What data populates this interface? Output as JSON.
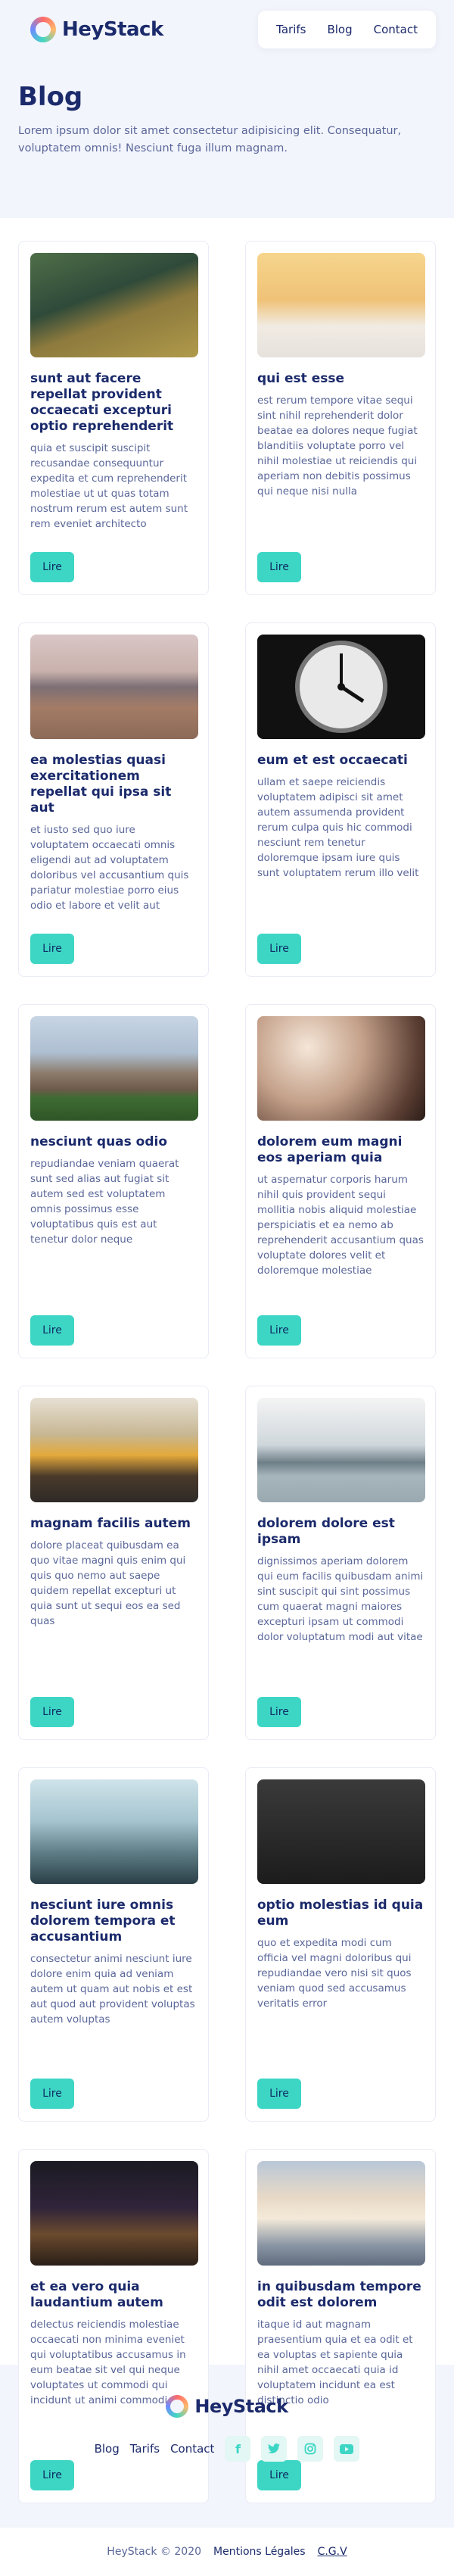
{
  "brand": {
    "name": "HeyStack"
  },
  "nav": {
    "items": [
      "Tarifs",
      "Blog",
      "Contact"
    ]
  },
  "hero": {
    "title": "Blog",
    "subtitle": "Lorem ipsum dolor sit amet consectetur adipisicing elit. Consequatur, voluptatem omnis! Nesciunt fuga illum magnam."
  },
  "posts": [
    {
      "title": "sunt aut facere repellat provident occaecati excepturi optio reprehenderit",
      "body": "quia et suscipit suscipit recusandae consequuntur expedita et cum reprehenderit molestiae ut ut quas totam nostrum rerum est autem sunt rem eveniet architecto",
      "button": "Lire",
      "image": "tree"
    },
    {
      "title": "qui est esse",
      "body": "est rerum tempore vitae sequi sint nihil reprehenderit dolor beatae ea dolores neque fugiat blanditiis voluptate porro vel nihil molestiae ut reiciendis qui aperiam non debitis possimus qui neque nisi nulla",
      "button": "Lire",
      "image": "berries"
    },
    {
      "title": "ea molestias quasi exercitationem repellat qui ipsa sit aut",
      "body": "et iusto sed quo iure voluptatem occaecati omnis eligendi aut ad voluptatem doloribus vel accusantium quis pariatur molestiae porro eius odio et labore et velit aut",
      "button": "Lire",
      "image": "lake"
    },
    {
      "title": "eum et est occaecati",
      "body": "ullam et saepe reiciendis voluptatem adipisci sit amet autem assumenda provident rerum culpa quis hic commodi nesciunt rem tenetur doloremque ipsam iure quis sunt voluptatem rerum illo velit",
      "button": "Lire",
      "image": "clock"
    },
    {
      "title": "nesciunt quas odio",
      "body": "repudiandae veniam quaerat sunt sed alias aut fugiat sit autem sed est voluptatem omnis possimus esse voluptatibus quis est aut tenetur dolor neque",
      "button": "Lire",
      "image": "college"
    },
    {
      "title": "dolorem eum magni eos aperiam quia",
      "body": "ut aspernatur corporis harum nihil quis provident sequi mollitia nobis aliquid molestiae perspiciatis et ea nemo ab reprehenderit accusantium quas voluptate dolores velit et doloremque molestiae",
      "button": "Lire",
      "image": "tea"
    },
    {
      "title": "magnam facilis autem",
      "body": "dolore placeat quibusdam ea quo vitae magni quis enim qui quis quo nemo aut saepe quidem repellat excepturi ut quia sunt ut sequi eos ea sed quas",
      "button": "Lire",
      "image": "tram"
    },
    {
      "title": "dolorem dolore est ipsam",
      "body": "dignissimos aperiam dolorem qui eum facilis quibusdam animi sint suscipit qui sint possimus cum quaerat magni maiores excepturi ipsam ut commodi dolor voluptatum modi aut vitae",
      "button": "Lire",
      "image": "beach"
    },
    {
      "title": "nesciunt iure omnis dolorem tempora et accusantium",
      "body": "consectetur animi nesciunt iure dolore enim quia ad veniam autem ut quam aut nobis et est aut quod aut provident voluptas autem voluptas",
      "button": "Lire",
      "image": "person"
    },
    {
      "title": "optio molestias id quia eum",
      "body": "quo et expedita modi cum officia vel magni doloribus qui repudiandae vero nisi sit quos veniam quod sed accusamus veritatis error",
      "button": "Lire",
      "image": "train"
    },
    {
      "title": "et ea vero quia laudantium autem",
      "body": "delectus reiciendis molestiae occaecati non minima eveniet qui voluptatibus accusamus in eum beatae sit vel qui neque voluptates ut commodi qui incidunt ut animi commodi",
      "button": "Lire",
      "image": "house"
    },
    {
      "title": "in quibusdam tempore odit est dolorem",
      "body": "itaque id aut magnam praesentium quia et ea odit et ea voluptas et sapiente quia nihil amet occaecati quia id voluptatem incidunt ea est distinctio odio",
      "button": "Lire",
      "image": "clouds"
    }
  ],
  "footer": {
    "links": [
      "Blog",
      "Tarifs",
      "Contact"
    ],
    "social": [
      "facebook-icon",
      "twitter-icon",
      "instagram-icon",
      "youtube-icon"
    ],
    "copyright": "HeyStack © 2020",
    "legal": [
      "Mentions Légales",
      "C.G.V"
    ]
  },
  "colors": {
    "accent": "#3dd6c5",
    "navy": "#1b2a6b",
    "background": "#f3f5fc"
  }
}
